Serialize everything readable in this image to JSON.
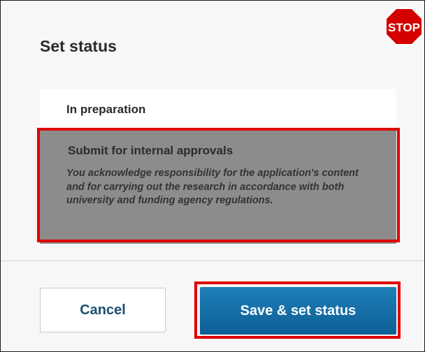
{
  "dialog": {
    "title": "Set status"
  },
  "status_options": [
    {
      "label": "In preparation"
    },
    {
      "label": "Submit for internal approvals",
      "description": "You acknowledge responsibility for the application's content and for carrying out the research in accordance with both university and funding agency regulations.",
      "selected": true
    }
  ],
  "buttons": {
    "cancel_label": "Cancel",
    "save_label": "Save & set status"
  },
  "stop_sign": {
    "text": "STOP"
  },
  "colors": {
    "highlight": "#e00000",
    "selected_option": "#8c8c8c",
    "primary_button": "#0d6aa3",
    "cancel_text": "#1b4f73"
  }
}
